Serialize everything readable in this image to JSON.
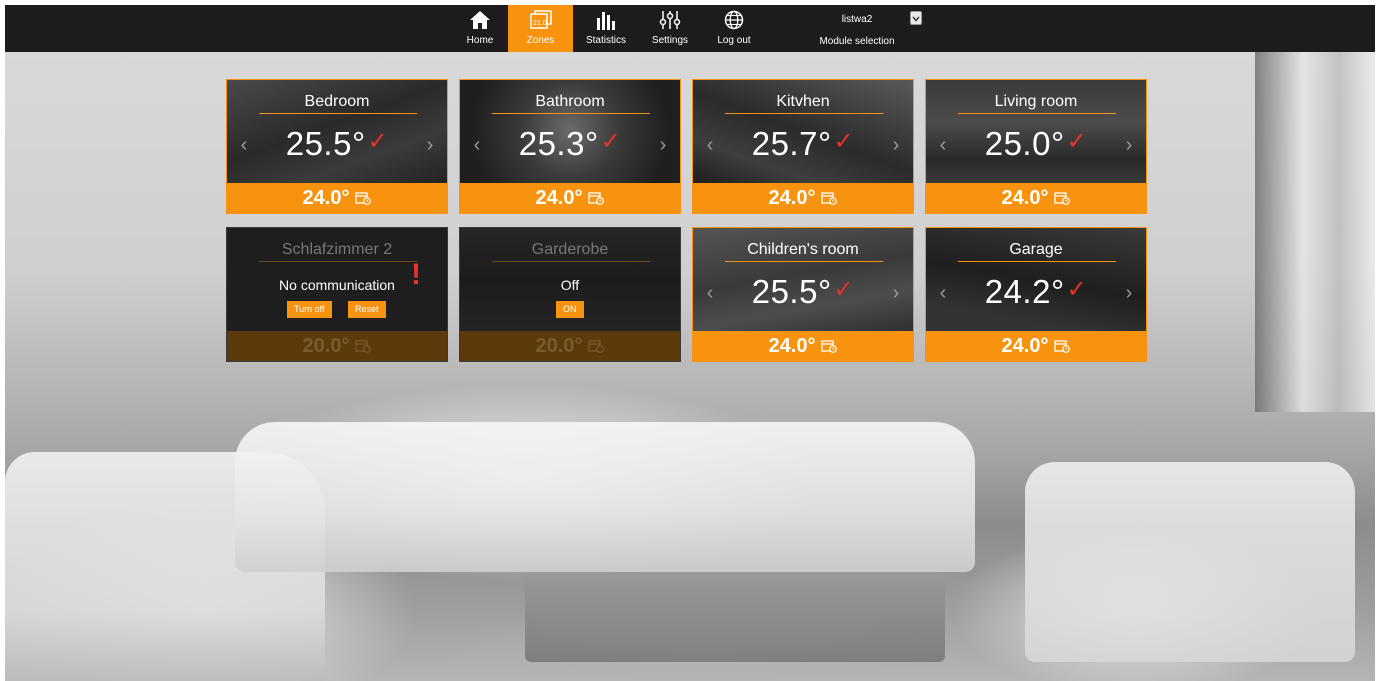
{
  "nav": {
    "items": [
      {
        "label": "Home",
        "icon": "home-icon"
      },
      {
        "label": "Zones",
        "icon": "zones-icon",
        "active": true
      },
      {
        "label": "Statistics",
        "icon": "statistics-icon"
      },
      {
        "label": "Settings",
        "icon": "settings-icon"
      },
      {
        "label": "Log out",
        "icon": "globe-icon"
      }
    ],
    "module": {
      "value": "listwa2",
      "caption": "Module selection"
    }
  },
  "colors": {
    "accent": "#f7930e",
    "check": "#e8322c",
    "topbar": "#1c1c1c"
  },
  "zones": [
    {
      "name": "Bedroom",
      "temperature": "25.5°",
      "setpoint": "24.0°",
      "status": "ok"
    },
    {
      "name": "Bathroom",
      "temperature": "25.3°",
      "setpoint": "24.0°",
      "status": "ok"
    },
    {
      "name": "Kitvhen",
      "temperature": "25.7°",
      "setpoint": "24.0°",
      "status": "ok"
    },
    {
      "name": "Living room",
      "temperature": "25.0°",
      "setpoint": "24.0°",
      "status": "ok"
    },
    {
      "name": "Schlafzimmer 2",
      "message": "No communication",
      "setpoint": "20.0°",
      "status": "error",
      "buttons": {
        "turn_off": "Turn off",
        "reset": "Reset"
      },
      "alert": "!"
    },
    {
      "name": "Garderobe",
      "message": "Off",
      "setpoint": "20.0°",
      "status": "off",
      "buttons": {
        "on": "ON"
      }
    },
    {
      "name": "Children's room",
      "temperature": "25.5°",
      "setpoint": "24.0°",
      "status": "ok"
    },
    {
      "name": "Garage",
      "temperature": "24.2°",
      "setpoint": "24.0°",
      "status": "ok"
    }
  ]
}
